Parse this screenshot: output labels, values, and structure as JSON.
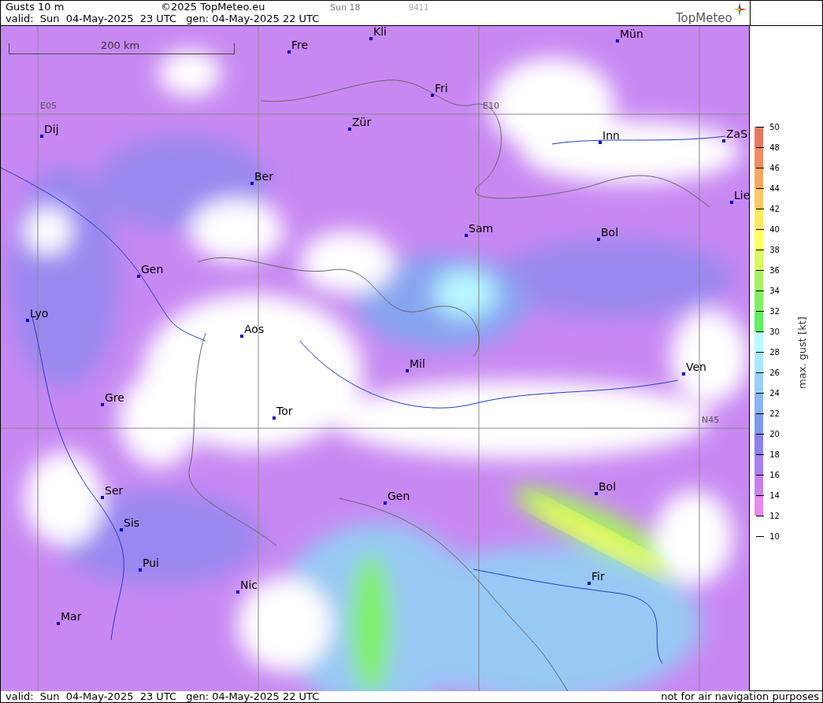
{
  "header": {
    "title": "Gusts 10 m",
    "copyright": "©2025 TopMeteo.eu",
    "run": "Sun 18",
    "code": "9411",
    "valid": "valid:  Sun  04-May-2025  23 UTC",
    "generated": "gen: 04-May-2025 22 UTC",
    "logo": "TopMeteo"
  },
  "map": {
    "scale": "200 km",
    "grid_labels": [
      "E05",
      "E10",
      "N45"
    ],
    "cities": [
      {
        "name": "Kli"
      },
      {
        "name": "Mün"
      },
      {
        "name": "Fre"
      },
      {
        "name": "Fri"
      },
      {
        "name": "Dij"
      },
      {
        "name": "Zür"
      },
      {
        "name": "Inn"
      },
      {
        "name": "ZaS"
      },
      {
        "name": "Ber"
      },
      {
        "name": "Lie"
      },
      {
        "name": "Sam"
      },
      {
        "name": "Bol"
      },
      {
        "name": "Gen"
      },
      {
        "name": "Lyo"
      },
      {
        "name": "Aos"
      },
      {
        "name": "Mil"
      },
      {
        "name": "Ven"
      },
      {
        "name": "Gre"
      },
      {
        "name": "Tor"
      },
      {
        "name": "Ser"
      },
      {
        "name": "Gen"
      },
      {
        "name": "Bol"
      },
      {
        "name": "Sis"
      },
      {
        "name": "Pui"
      },
      {
        "name": "Fir"
      },
      {
        "name": "Nic"
      },
      {
        "name": "Mar"
      }
    ]
  },
  "legend": {
    "title": "max. gust [kt]",
    "ticks": [
      "50",
      "48",
      "46",
      "44",
      "42",
      "40",
      "38",
      "36",
      "34",
      "32",
      "30",
      "28",
      "26",
      "24",
      "22",
      "20",
      "18",
      "16",
      "14",
      "12",
      "10"
    ],
    "bands": [
      {
        "color": "#e87860"
      },
      {
        "color": "#f08c60"
      },
      {
        "color": "#f8a860"
      },
      {
        "color": "#ffc860"
      },
      {
        "color": "#ffe860"
      },
      {
        "color": "#ffff60"
      },
      {
        "color": "#d8f860"
      },
      {
        "color": "#a8f060"
      },
      {
        "color": "#80f060"
      },
      {
        "color": "#60f060"
      },
      {
        "color": "#b8f8ff"
      },
      {
        "color": "#a8e8fc"
      },
      {
        "color": "#98d0f8"
      },
      {
        "color": "#88b4f4"
      },
      {
        "color": "#7898f0"
      },
      {
        "color": "#8c80f0"
      },
      {
        "color": "#a880f0"
      },
      {
        "color": "#c880f0"
      },
      {
        "color": "#e888f0"
      }
    ]
  },
  "footer": {
    "valid": "valid:  Sun  04-May-2025  23 UTC",
    "generated": "gen: 04-May-2025 22 UTC",
    "notice": "not for air navigation purposes"
  }
}
